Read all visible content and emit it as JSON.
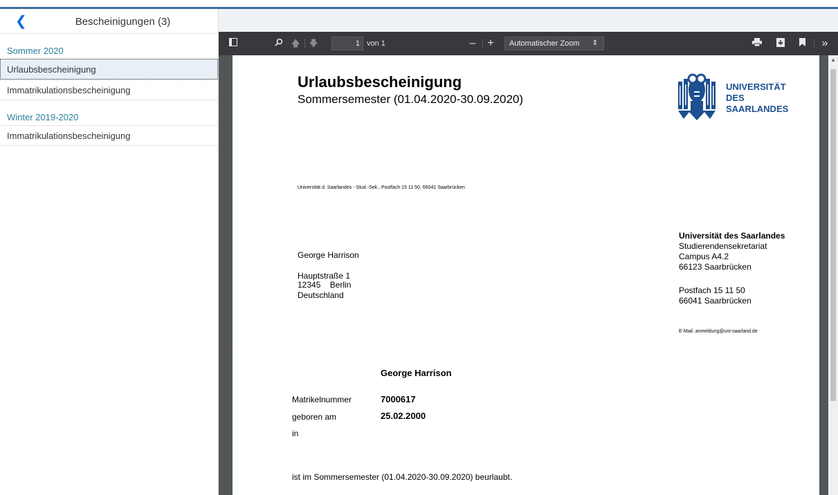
{
  "left_panel": {
    "title": "Bescheinigungen (3)",
    "groups": [
      {
        "title": "Sommer 2020",
        "items": [
          "Urlaubsbescheinigung",
          "Immatrikulationsbescheinigung"
        ]
      },
      {
        "title": "Winter 2019-2020",
        "items": [
          "Immatrikulationsbescheinigung"
        ]
      }
    ]
  },
  "toolbar": {
    "page_number": "1",
    "page_of": "von 1",
    "zoom": "Automatischer Zoom"
  },
  "document": {
    "title": "Urlaubsbescheinigung",
    "subtitle": "Sommersemester (01.04.2020-30.09.2020)",
    "logo": {
      "line1": "UNIVERSITÄT",
      "line2": "DES",
      "line3": "SAARLANDES"
    },
    "sender_line": "Universität d. Saarlandes - Stud.-Sek., Postfach 15 11 50, 66041 Saarbrücken",
    "recipient": {
      "name": "George Harrison",
      "street": "Hauptstraße  1",
      "city": "12345    Berlin",
      "country": "Deutschland"
    },
    "office": {
      "name": "Universität des Saarlandes",
      "dept": "Studierendensekretariat",
      "campus": "Campus A4.2",
      "city": "66123 Saarbrücken",
      "postbox": "Postfach 15 11 50",
      "postbox_city": "66041 Saarbrücken",
      "email": "E-Mail: anmeldung@uni-saarland.de"
    },
    "student_name": "George Harrison",
    "matrikel_label": "Matrikelnummer",
    "matrikel_value": "7000617",
    "born_label": "geboren am",
    "born_value": "25.02.2000",
    "in_label": "in",
    "statement": "ist im Sommersemester (01.04.2020-30.09.2020) beurlaubt."
  }
}
